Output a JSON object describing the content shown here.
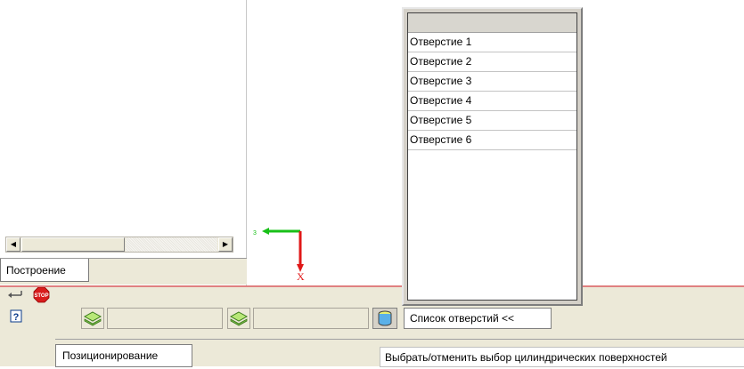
{
  "tree_panel": {
    "tab_build_label": "Построение"
  },
  "axis_triad": {
    "x_label": "X",
    "green_axis_label": "3",
    "colors": {
      "x_axis": "#e01818",
      "green_axis": "#18c018"
    }
  },
  "holes_list": {
    "header": "",
    "items": [
      "Отверстие 1",
      "Отверстие 2",
      "Отверстие 3",
      "Отверстие 4",
      "Отверстие 5",
      "Отверстие 6"
    ]
  },
  "side_icons": {
    "enter": "enter-arrow-icon",
    "stop": "stop-icon",
    "stop_label": "STOP",
    "help": "help-icon",
    "help_label": "?"
  },
  "command_bar": {
    "field1_value": "",
    "field2_value": "",
    "holes_button_label": "Список отверстий  <<",
    "layer_icon": "layers-icon",
    "cylinder_icon": "cylinder-icon"
  },
  "bottom_tabs": {
    "positioning_label": "Позиционирование",
    "hint": "Выбрать/отменить выбор цилиндрических поверхностей"
  }
}
